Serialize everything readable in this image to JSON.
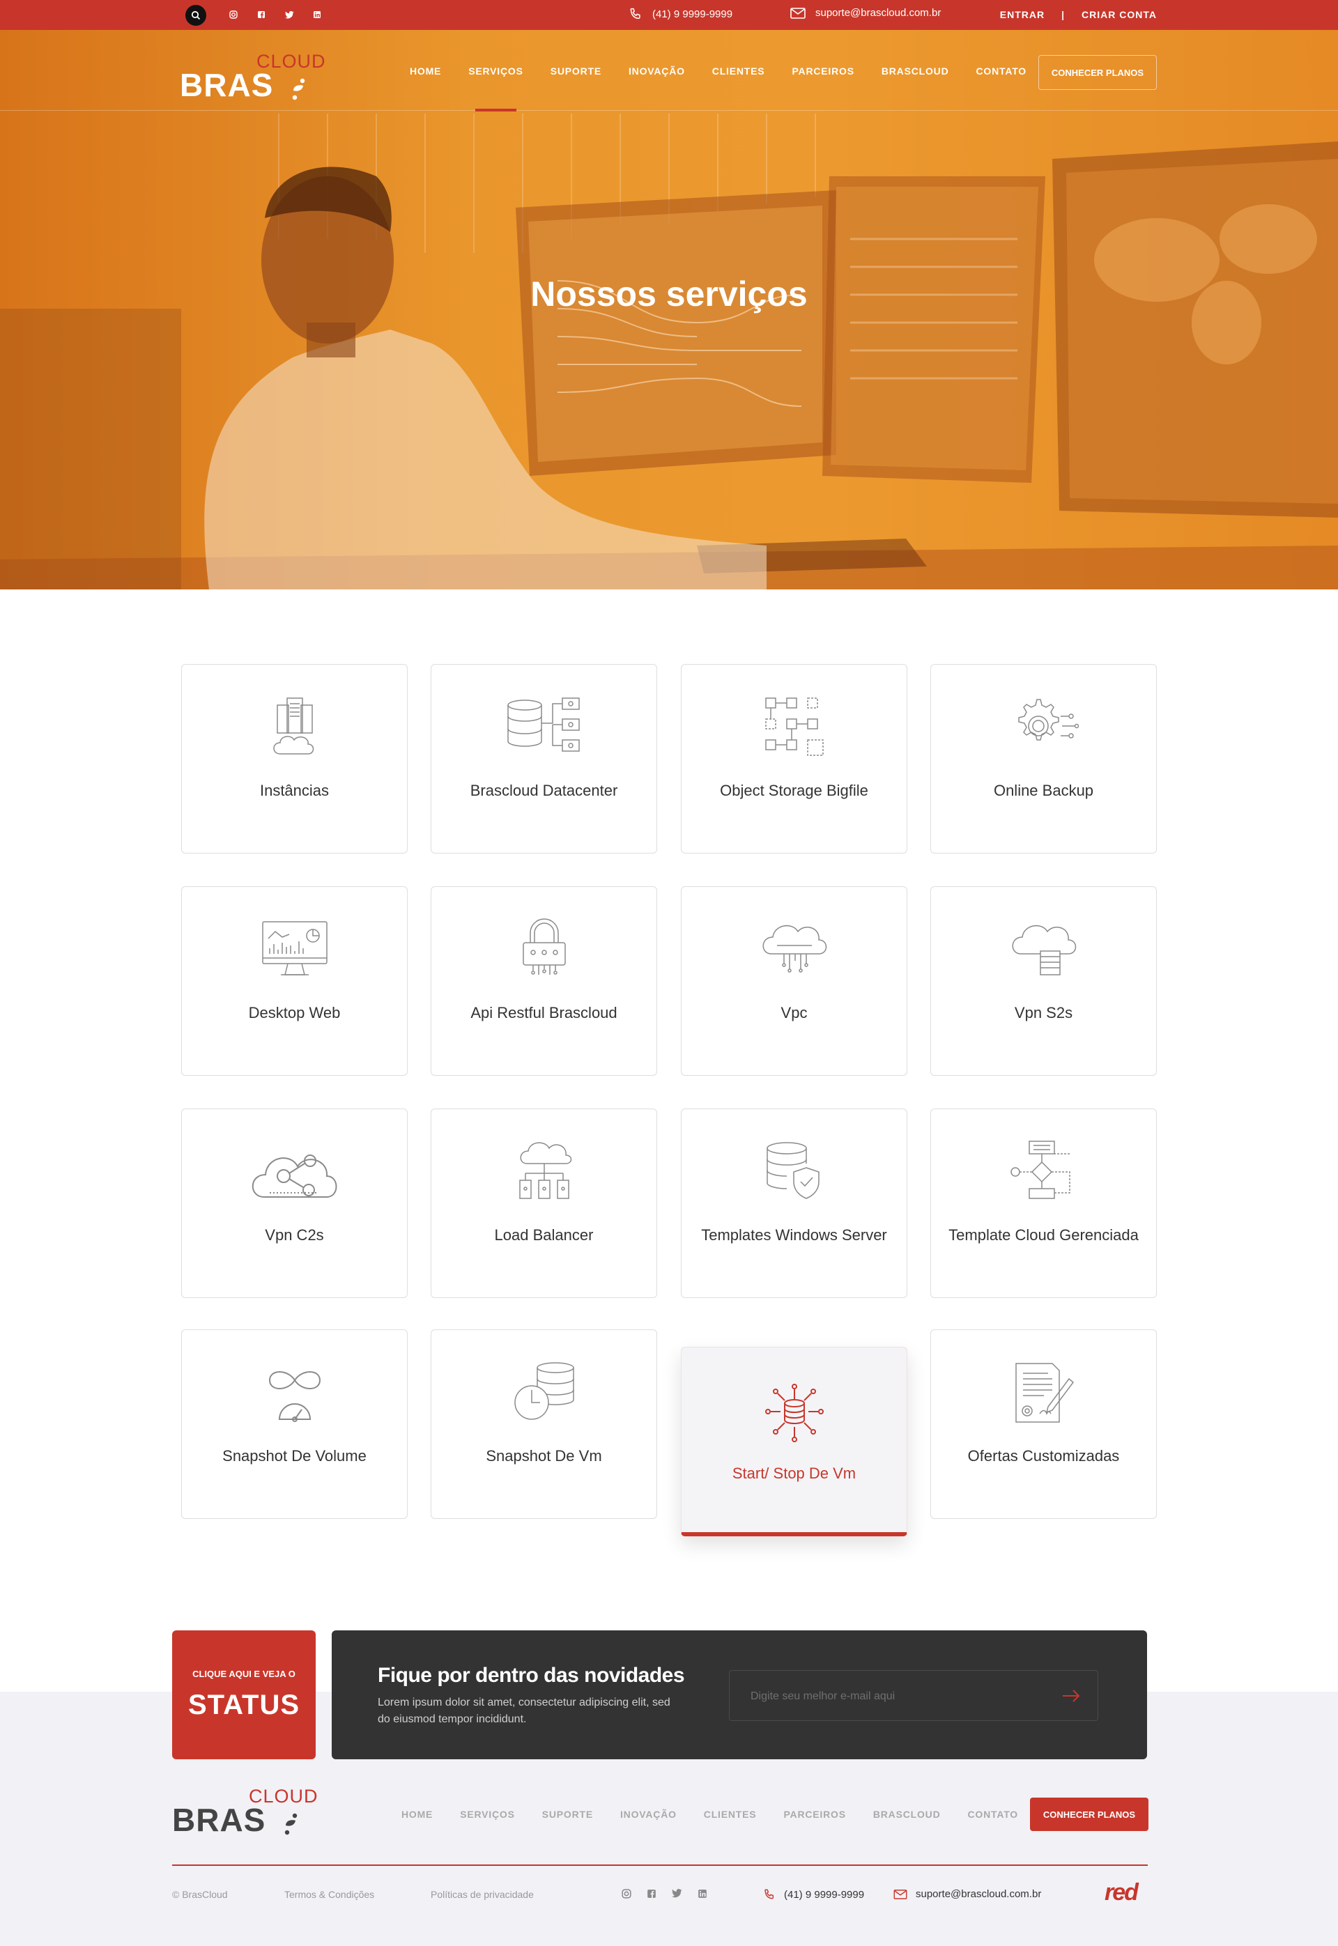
{
  "topbar": {
    "phone": "(41) 9 9999-9999",
    "email": "suporte@brascloud.com.br",
    "login": "ENTRAR",
    "separator": "|",
    "signup": "CRIAR CONTA",
    "social_icons": [
      "instagram-icon",
      "facebook-icon",
      "twitter-icon",
      "linkedin-icon"
    ]
  },
  "brand": {
    "main": "BRAS",
    "accent": "CLOUD"
  },
  "nav": {
    "items": [
      "HOME",
      "SERVIÇOS",
      "SUPORTE",
      "INOVAÇÃO",
      "CLIENTES",
      "PARCEIROS",
      "BRASCLOUD",
      "CONTATO"
    ],
    "active": "SERVIÇOS",
    "cta": "CONHECER PLANOS"
  },
  "hero": {
    "title": "Nossos serviços"
  },
  "services": [
    {
      "label": "Instâncias",
      "icon": "server-cloud-icon"
    },
    {
      "label": "Brascloud Datacenter",
      "icon": "database-network-icon"
    },
    {
      "label": "Object Storage Bigfile",
      "icon": "object-grid-icon"
    },
    {
      "label": "Online Backup",
      "icon": "gear-network-icon"
    },
    {
      "label": "Desktop Web",
      "icon": "desktop-chart-icon"
    },
    {
      "label": "Api Restful Brascloud",
      "icon": "lock-circuit-icon"
    },
    {
      "label": "Vpc",
      "icon": "cloud-circuit-icon"
    },
    {
      "label": "Vpn S2s",
      "icon": "cloud-server-icon"
    },
    {
      "label": "Vpn C2s",
      "icon": "cloud-share-icon"
    },
    {
      "label": "Load Balancer",
      "icon": "cloud-balancer-icon"
    },
    {
      "label": "Templates Windows Server",
      "icon": "database-shield-icon"
    },
    {
      "label": "Template Cloud Gerenciada",
      "icon": "flowchart-icon"
    },
    {
      "label": "Snapshot De Volume",
      "icon": "infinity-gauge-icon"
    },
    {
      "label": "Snapshot De Vm",
      "icon": "clock-database-icon"
    },
    {
      "label": "Start/ Stop De Vm",
      "icon": "database-nodes-icon",
      "active": true
    },
    {
      "label": "Ofertas Customizadas",
      "icon": "document-pen-icon"
    }
  ],
  "status": {
    "small": "CLIQUE AQUI E VEJA O",
    "big": "STATUS"
  },
  "newsletter": {
    "title": "Fique por dentro das novidades",
    "description": "Lorem ipsum dolor sit amet, consectetur adipiscing elit, sed do eiusmod tempor incididunt.",
    "placeholder": "Digite seu melhor e-mail aqui"
  },
  "footer": {
    "nav": [
      "HOME",
      "SERVIÇOS",
      "SUPORTE",
      "INOVAÇÃO",
      "CLIENTES",
      "PARCEIROS",
      "BRASCLOUD",
      "CONTATO"
    ],
    "cta": "CONHECER PLANOS",
    "copyright": "© BrasCloud",
    "terms": "Termos & Condições",
    "privacy": "Políticas de privacidade",
    "phone": "(41) 9 9999-9999",
    "email": "suporte@brascloud.com.br",
    "partner_logo": "red"
  },
  "colors": {
    "accent": "#c8362b",
    "hero_overlay": "#e9962c",
    "dark_panel": "#333333",
    "footer_bg": "#f2f1f6"
  }
}
